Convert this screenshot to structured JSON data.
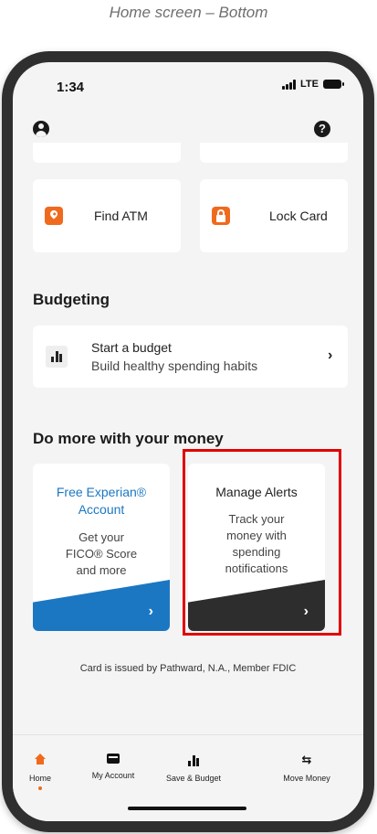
{
  "caption": "Home screen – Bottom",
  "status_bar": {
    "time": "1:34",
    "network": "LTE"
  },
  "quick_actions": [
    {
      "label": "Find ATM",
      "icon": "location-pin-icon"
    },
    {
      "label": "Lock Card",
      "icon": "lock-icon"
    }
  ],
  "budgeting": {
    "title": "Budgeting",
    "card_title": "Start a budget",
    "card_subtitle": "Build healthy spending habits"
  },
  "do_more": {
    "title": "Do more with your money",
    "experian": {
      "title_line1": "Free Experian®",
      "title_line2": "Account",
      "body_line1": "Get your",
      "body_line2": "FICO® Score",
      "body_line3": "and more"
    },
    "alerts": {
      "title": "Manage Alerts",
      "body_line1": "Track your",
      "body_line2": "money with",
      "body_line3": "spending",
      "body_line4": "notifications"
    }
  },
  "footer_note": "Card is issued by Pathward, N.A., Member FDIC",
  "nav": {
    "home": "Home",
    "my_account": "My Account",
    "save_budget": "Save & Budget",
    "move_money": "Move Money",
    "active": "Home"
  },
  "colors": {
    "accent": "#f06a1d",
    "experian_blue": "#1b77c2",
    "dark": "#2d2d2d",
    "highlight": "#e20000"
  }
}
